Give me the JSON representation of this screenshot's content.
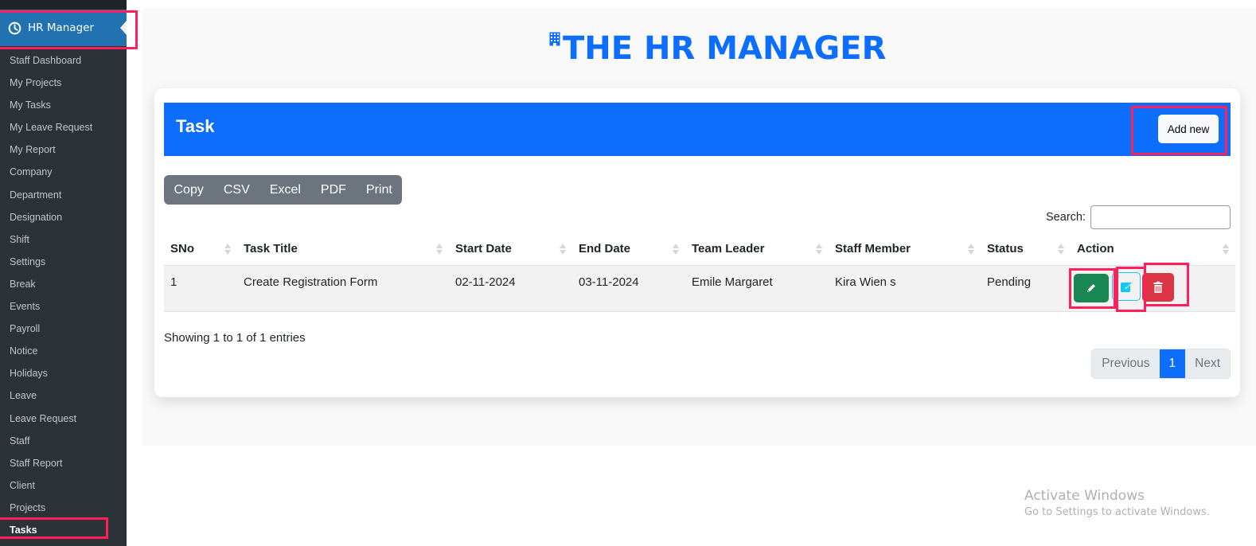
{
  "sidebar": {
    "header": {
      "label": "HR Manager",
      "icon": "clock-icon"
    },
    "items": [
      {
        "label": "Staff Dashboard"
      },
      {
        "label": "My Projects"
      },
      {
        "label": "My Tasks"
      },
      {
        "label": "My Leave Request"
      },
      {
        "label": "My Report"
      },
      {
        "label": "Company"
      },
      {
        "label": "Department"
      },
      {
        "label": "Designation"
      },
      {
        "label": "Shift"
      },
      {
        "label": "Settings"
      },
      {
        "label": "Break"
      },
      {
        "label": "Events"
      },
      {
        "label": "Payroll"
      },
      {
        "label": "Notice"
      },
      {
        "label": "Holidays"
      },
      {
        "label": "Leave"
      },
      {
        "label": "Leave Request"
      },
      {
        "label": "Staff"
      },
      {
        "label": "Staff Report"
      },
      {
        "label": "Client"
      },
      {
        "label": "Projects"
      },
      {
        "label": "Tasks",
        "current": true
      }
    ]
  },
  "header": {
    "title": "THE HR MANAGER",
    "icon": "building-icon"
  },
  "card": {
    "title": "Task",
    "add_label": "Add new"
  },
  "export_buttons": [
    "Copy",
    "CSV",
    "Excel",
    "PDF",
    "Print"
  ],
  "search": {
    "label": "Search:",
    "value": "",
    "placeholder": ""
  },
  "table": {
    "columns": [
      "SNo",
      "Task Title",
      "Start Date",
      "End Date",
      "Team Leader",
      "Staff Member",
      "Status",
      "Action"
    ],
    "rows": [
      {
        "sno": "1",
        "title": "Create Registration Form",
        "start": "02-11-2024",
        "end": "03-11-2024",
        "leader": "Emile Margaret",
        "staff": "Kira Wien s",
        "status": "Pending",
        "actions": [
          "edit",
          "view-edit",
          "delete"
        ]
      }
    ]
  },
  "footer": {
    "info": "Showing 1 to 1 of 1 entries",
    "previous": "Previous",
    "page": "1",
    "next": "Next"
  },
  "watermark": {
    "line1": "Activate Windows",
    "line2": "Go to Settings to activate Windows."
  },
  "colors": {
    "primary": "#0d6efd",
    "sidebar_bg": "#2c3338",
    "sidebar_active": "#2271b1",
    "success": "#198754",
    "danger": "#dc3545",
    "info": "#0dcaf0",
    "secondary": "#6c757d",
    "highlight": "#ff1f5a"
  }
}
